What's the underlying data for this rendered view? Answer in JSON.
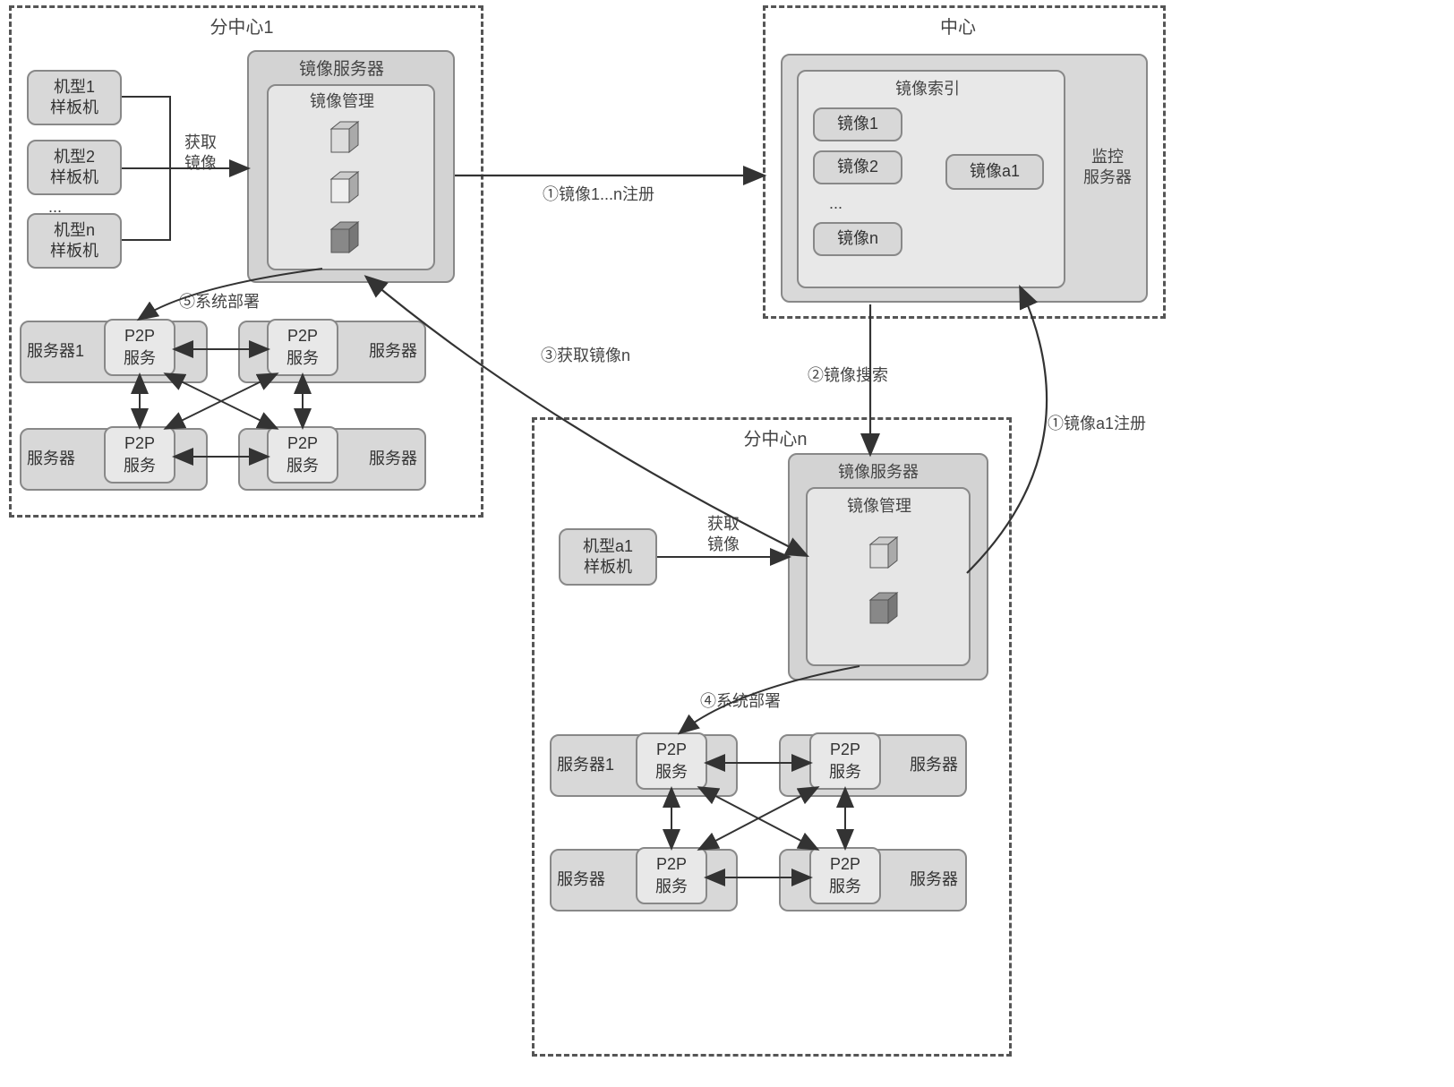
{
  "subcenter1": {
    "title": "分中心1",
    "templates": [
      {
        "line1": "机型1",
        "line2": "样板机"
      },
      {
        "line1": "机型2",
        "line2": "样板机"
      },
      {
        "line1": "机型n",
        "line2": "样板机"
      }
    ],
    "ellipsis": "...",
    "get_image_label": "获取\n镜像",
    "mirror_server_title": "镜像服务器",
    "mirror_mgmt_title": "镜像管理",
    "deploy_label": "⑤系统部署",
    "servers": [
      {
        "label": "服务器1",
        "p2p": "P2P\n服务"
      },
      {
        "label": "服务器",
        "p2p": "P2P\n服务"
      },
      {
        "label": "服务器",
        "p2p": "P2P\n服务"
      },
      {
        "label": "服务器",
        "p2p": "P2P\n服务"
      }
    ]
  },
  "center": {
    "title": "中心",
    "monitor_server": "监控\n服务器",
    "mirror_index_title": "镜像索引",
    "mirrors": [
      "镜像1",
      "镜像2",
      "镜像n"
    ],
    "mirror_a1": "镜像a1",
    "ellipsis": "..."
  },
  "arrows_labels": {
    "register_1n": "①镜像1...n注册",
    "search": "②镜像搜索",
    "get_n": "③获取镜像n",
    "deploy_n": "④系统部署",
    "register_a1": "①镜像a1注册"
  },
  "subcenterN": {
    "title": "分中心n",
    "template": {
      "line1": "机型a1",
      "line2": "样板机"
    },
    "get_image_label": "获取\n镜像",
    "mirror_server_title": "镜像服务器",
    "mirror_mgmt_title": "镜像管理",
    "servers": [
      {
        "label": "服务器1",
        "p2p": "P2P\n服务"
      },
      {
        "label": "服务器",
        "p2p": "P2P\n服务"
      },
      {
        "label": "服务器",
        "p2p": "P2P\n服务"
      },
      {
        "label": "服务器",
        "p2p": "P2P\n服务"
      }
    ]
  }
}
